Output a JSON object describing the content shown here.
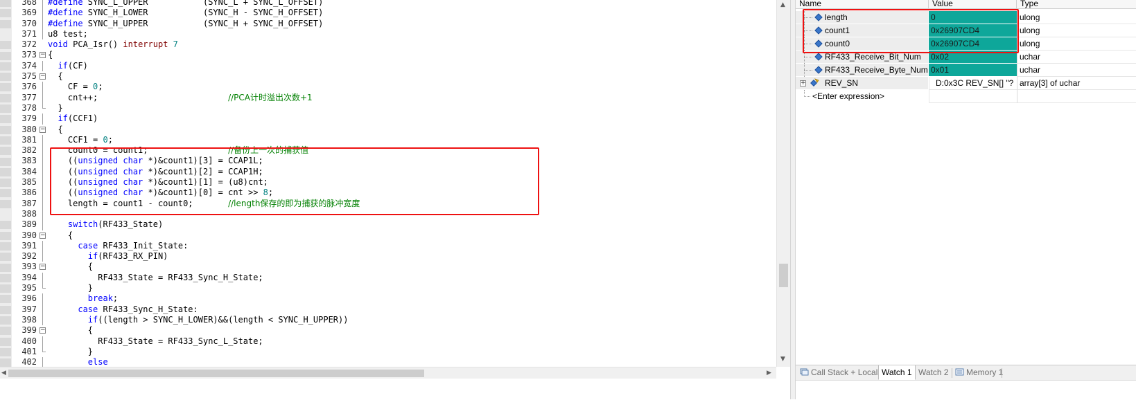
{
  "editor": {
    "lines": [
      {
        "n": "368",
        "fold": "line",
        "bp": true,
        "parts": [
          [
            "pp",
            "#define"
          ],
          [
            "plain",
            " SYNC_L_UPPER           (SYNC_L + SYNC_L_OFFSET)"
          ]
        ]
      },
      {
        "n": "369",
        "fold": "line",
        "bp": true,
        "parts": [
          [
            "pp",
            "#define"
          ],
          [
            "plain",
            " SYNC_H_LOWER           (SYNC_H - SYNC_H_OFFSET)"
          ]
        ]
      },
      {
        "n": "370",
        "fold": "line",
        "bp": true,
        "parts": [
          [
            "pp",
            "#define"
          ],
          [
            "plain",
            " SYNC_H_UPPER           (SYNC_H + SYNC_H_OFFSET)"
          ]
        ]
      },
      {
        "n": "371",
        "fold": "line",
        "bp": false,
        "parts": [
          [
            "plain",
            "u8 test;"
          ]
        ]
      },
      {
        "n": "372",
        "fold": "none",
        "bp": true,
        "parts": [
          [
            "kw",
            "void"
          ],
          [
            "plain",
            " PCA_Isr() "
          ],
          [
            "macro",
            "interrupt"
          ],
          [
            "plain",
            " "
          ],
          [
            "num",
            "7"
          ]
        ]
      },
      {
        "n": "373",
        "fold": "open",
        "bp": true,
        "parts": [
          [
            "plain",
            "{"
          ]
        ]
      },
      {
        "n": "374",
        "fold": "line",
        "bp": true,
        "parts": [
          [
            "plain",
            "  "
          ],
          [
            "kw",
            "if"
          ],
          [
            "plain",
            "(CF)"
          ]
        ]
      },
      {
        "n": "375",
        "fold": "open",
        "bp": true,
        "parts": [
          [
            "plain",
            "  {"
          ]
        ]
      },
      {
        "n": "376",
        "fold": "line",
        "bp": true,
        "parts": [
          [
            "plain",
            "    CF = "
          ],
          [
            "num",
            "0"
          ],
          [
            "plain",
            ";"
          ]
        ]
      },
      {
        "n": "377",
        "fold": "line",
        "bp": true,
        "parts": [
          [
            "plain",
            "    cnt++;                          "
          ],
          [
            "cmt",
            "//PCA计时溢出次数+1"
          ]
        ]
      },
      {
        "n": "378",
        "fold": "end",
        "bp": true,
        "parts": [
          [
            "plain",
            "  }"
          ]
        ]
      },
      {
        "n": "379",
        "fold": "line",
        "bp": true,
        "parts": [
          [
            "plain",
            "  "
          ],
          [
            "kw",
            "if"
          ],
          [
            "plain",
            "(CCF1)"
          ]
        ]
      },
      {
        "n": "380",
        "fold": "open",
        "bp": true,
        "parts": [
          [
            "plain",
            "  {"
          ]
        ]
      },
      {
        "n": "381",
        "fold": "line",
        "bp": true,
        "parts": [
          [
            "plain",
            "    CCF1 = "
          ],
          [
            "num",
            "0"
          ],
          [
            "plain",
            ";"
          ]
        ]
      },
      {
        "n": "382",
        "fold": "line",
        "bp": true,
        "parts": [
          [
            "plain",
            "    count0 = count1;                "
          ],
          [
            "cmt",
            "//备份上一次的捕获值"
          ]
        ]
      },
      {
        "n": "383",
        "fold": "line",
        "bp": true,
        "parts": [
          [
            "plain",
            "    (("
          ],
          [
            "kw",
            "unsigned char"
          ],
          [
            "plain",
            " *)&count1)[3] = CCAP1L;"
          ]
        ]
      },
      {
        "n": "384",
        "fold": "line",
        "bp": true,
        "parts": [
          [
            "plain",
            "    (("
          ],
          [
            "kw",
            "unsigned char"
          ],
          [
            "plain",
            " *)&count1)[2] = CCAP1H;"
          ]
        ]
      },
      {
        "n": "385",
        "fold": "line",
        "bp": true,
        "parts": [
          [
            "plain",
            "    (("
          ],
          [
            "kw",
            "unsigned char"
          ],
          [
            "plain",
            " *)&count1)[1] = (u8)cnt;"
          ]
        ]
      },
      {
        "n": "386",
        "fold": "line",
        "bp": true,
        "parts": [
          [
            "plain",
            "    (("
          ],
          [
            "kw",
            "unsigned char"
          ],
          [
            "plain",
            " *)&count1)[0] = cnt >> "
          ],
          [
            "num",
            "8"
          ],
          [
            "plain",
            ";"
          ]
        ]
      },
      {
        "n": "387",
        "fold": "line",
        "bp": true,
        "parts": [
          [
            "plain",
            "    length = count1 - count0;       "
          ],
          [
            "cmt",
            "//length保存的即为捕获的脉冲宽度"
          ]
        ]
      },
      {
        "n": "388",
        "fold": "line",
        "bp": false,
        "parts": [
          [
            "plain",
            ""
          ]
        ]
      },
      {
        "n": "389",
        "fold": "line",
        "bp": true,
        "parts": [
          [
            "plain",
            "    "
          ],
          [
            "kw",
            "switch"
          ],
          [
            "plain",
            "(RF433_State)"
          ]
        ]
      },
      {
        "n": "390",
        "fold": "open",
        "bp": true,
        "parts": [
          [
            "plain",
            "    {"
          ]
        ]
      },
      {
        "n": "391",
        "fold": "line",
        "bp": true,
        "parts": [
          [
            "plain",
            "      "
          ],
          [
            "kw",
            "case"
          ],
          [
            "plain",
            " RF433_Init_State:"
          ]
        ]
      },
      {
        "n": "392",
        "fold": "line",
        "bp": true,
        "parts": [
          [
            "plain",
            "        "
          ],
          [
            "kw",
            "if"
          ],
          [
            "plain",
            "(RF433_RX_PIN)"
          ]
        ]
      },
      {
        "n": "393",
        "fold": "open",
        "bp": true,
        "parts": [
          [
            "plain",
            "        {"
          ]
        ]
      },
      {
        "n": "394",
        "fold": "line",
        "bp": true,
        "parts": [
          [
            "plain",
            "          RF433_State = RF433_Sync_H_State;"
          ]
        ]
      },
      {
        "n": "395",
        "fold": "end",
        "bp": true,
        "parts": [
          [
            "plain",
            "        }"
          ]
        ]
      },
      {
        "n": "396",
        "fold": "line",
        "bp": true,
        "parts": [
          [
            "plain",
            "        "
          ],
          [
            "kw",
            "break"
          ],
          [
            "plain",
            ";"
          ]
        ]
      },
      {
        "n": "397",
        "fold": "line",
        "bp": true,
        "parts": [
          [
            "plain",
            "      "
          ],
          [
            "kw",
            "case"
          ],
          [
            "plain",
            " RF433_Sync_H_State:"
          ]
        ]
      },
      {
        "n": "398",
        "fold": "line",
        "bp": true,
        "parts": [
          [
            "plain",
            "        "
          ],
          [
            "kw",
            "if"
          ],
          [
            "plain",
            "((length > SYNC_H_LOWER)&&(length < SYNC_H_UPPER))"
          ]
        ]
      },
      {
        "n": "399",
        "fold": "open",
        "bp": true,
        "parts": [
          [
            "plain",
            "        {"
          ]
        ]
      },
      {
        "n": "400",
        "fold": "line",
        "bp": true,
        "parts": [
          [
            "plain",
            "          RF433_State = RF433_Sync_L_State;"
          ]
        ]
      },
      {
        "n": "401",
        "fold": "end",
        "bp": true,
        "parts": [
          [
            "plain",
            "        }"
          ]
        ]
      },
      {
        "n": "402",
        "fold": "line",
        "bp": true,
        "parts": [
          [
            "plain",
            "        "
          ],
          [
            "kw",
            "else"
          ]
        ]
      }
    ]
  },
  "watch": {
    "headers": {
      "name": "Name",
      "value": "Value",
      "type": "Type"
    },
    "rows": [
      {
        "name": "length",
        "value": "0",
        "type": "ulong",
        "highlight": true
      },
      {
        "name": "count1",
        "value": "0x26907CD4",
        "type": "ulong",
        "highlight": true
      },
      {
        "name": "count0",
        "value": "0x26907CD4",
        "type": "ulong",
        "highlight": true
      },
      {
        "name": "RF433_Receive_Bit_Num",
        "value": "0x02",
        "type": "uchar",
        "highlight": true
      },
      {
        "name": "RF433_Receive_Byte_Num",
        "value": "0x01",
        "type": "uchar",
        "highlight": true
      }
    ],
    "struct_row": {
      "expander": "+",
      "name": "REV_SN",
      "value": "D:0x3C REV_SN[] \"?",
      "type": "array[3] of uchar"
    },
    "enter_expression": "<Enter expression>",
    "tabs": [
      {
        "label": "Call Stack + Locals",
        "active": false,
        "icon": "call-stack-icon"
      },
      {
        "label": "Watch 1",
        "active": true
      },
      {
        "label": "Watch 2",
        "active": false
      },
      {
        "label": "Memory 1",
        "active": false,
        "icon": "memory-icon"
      }
    ]
  },
  "colors": {
    "highlight_bg": "#0ea79a",
    "annotation_red": "#ee1111",
    "keyword": "#0000ff",
    "comment": "#008000",
    "number": "#008080"
  }
}
